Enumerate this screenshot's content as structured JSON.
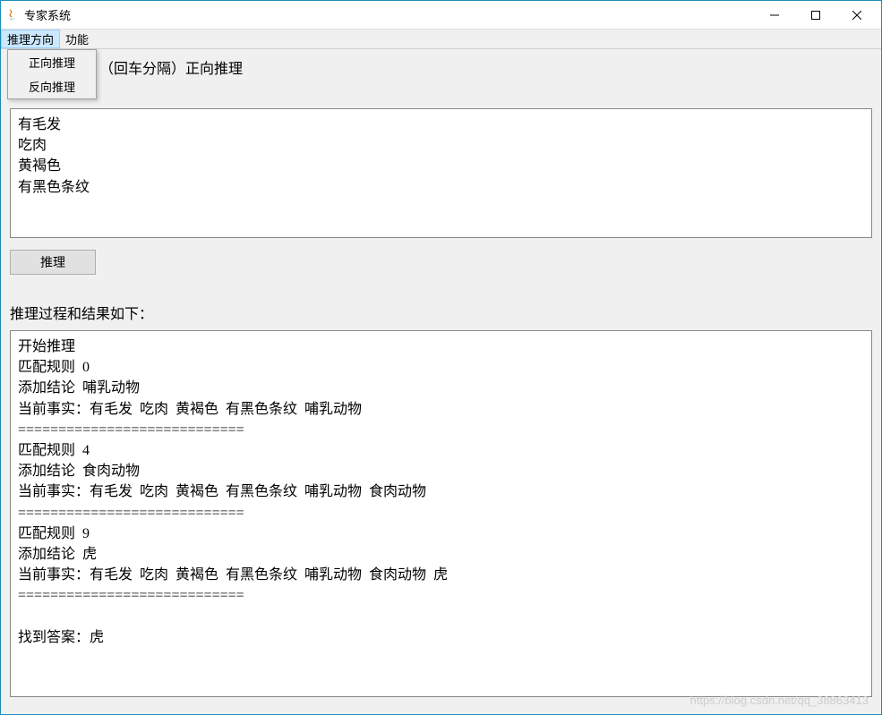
{
  "window": {
    "title": "专家系统"
  },
  "menubar": {
    "items": [
      "推理方向",
      "功能"
    ],
    "dropdown": {
      "items": [
        "正向推理",
        "反向推理"
      ]
    }
  },
  "input": {
    "label": "（回车分隔）正向推理",
    "value": "有毛发\n吃肉\n黄褐色\n有黑色条纹"
  },
  "buttons": {
    "reason": "推理"
  },
  "result": {
    "label": "推理过程和结果如下：",
    "text": "开始推理\n匹配规则  0\n添加结论  哺乳动物\n当前事实：有毛发  吃肉  黄褐色  有黑色条纹  哺乳动物  \n============================\n匹配规则  4\n添加结论  食肉动物\n当前事实：有毛发  吃肉  黄褐色  有黑色条纹  哺乳动物  食肉动物  \n============================\n匹配规则  9\n添加结论  虎\n当前事实：有毛发  吃肉  黄褐色  有黑色条纹  哺乳动物  食肉动物  虎  \n============================\n\n找到答案：虎"
  },
  "watermark": "https://blog.csdn.net/qq_38863413"
}
